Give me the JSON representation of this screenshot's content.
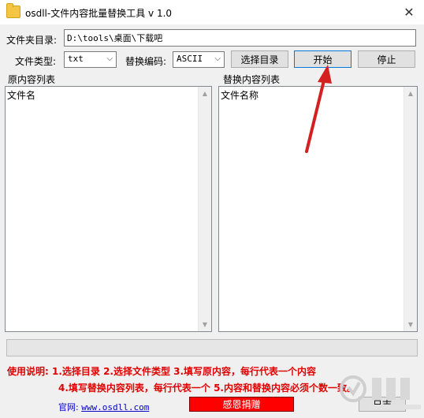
{
  "window": {
    "title": "osdll-文件内容批量替换工具 v 1.0",
    "close_glyph": "✕"
  },
  "form": {
    "folder_label": "文件夹目录:",
    "folder_value": "D:\\tools\\桌面\\下载吧",
    "filetype_label": "文件类型:",
    "filetype_value": "txt",
    "encoding_label": "替换编码:",
    "encoding_value": "ASCII"
  },
  "buttons": {
    "select_dir": "选择目录",
    "start": "开始",
    "stop": "停止",
    "donate": "感恩捐赠",
    "log": "日志"
  },
  "lists": {
    "original": {
      "title": "原内容列表",
      "first_line": "文件名"
    },
    "replace": {
      "title": "替换内容列表",
      "first_line": "文件名称"
    }
  },
  "instructions": {
    "line1": "使用说明:  1.选择目录    2.选择文件类型    3.填写原内容，每行代表一个内容",
    "line2": "4.填写替换内容列表，每行代表一个    5.内容和替换内容必须个数一致。"
  },
  "footer": {
    "site_label": "官网:",
    "site_url": "www.osdll.com"
  },
  "colors": {
    "instruction_red": "#e00000",
    "donate_red": "#ff0000",
    "annotation_arrow": "#d42020"
  }
}
